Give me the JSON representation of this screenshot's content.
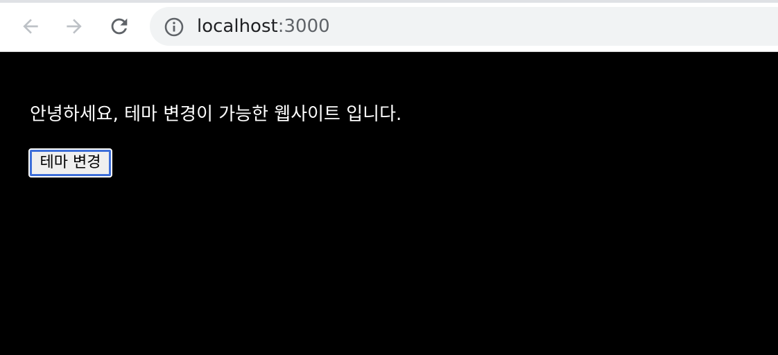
{
  "browser": {
    "url_host": "localhost",
    "url_port": ":3000",
    "icons": {
      "back": "arrow-left-icon",
      "forward": "arrow-right-icon",
      "reload": "reload-icon",
      "site_info": "info-icon"
    }
  },
  "page": {
    "background_color": "#000000",
    "greeting": "안녕하세요, 테마 변경이 가능한 웹사이트 입니다.",
    "theme_button_label": "테마 변경",
    "focus_ring_color": "#3d6ed9"
  }
}
